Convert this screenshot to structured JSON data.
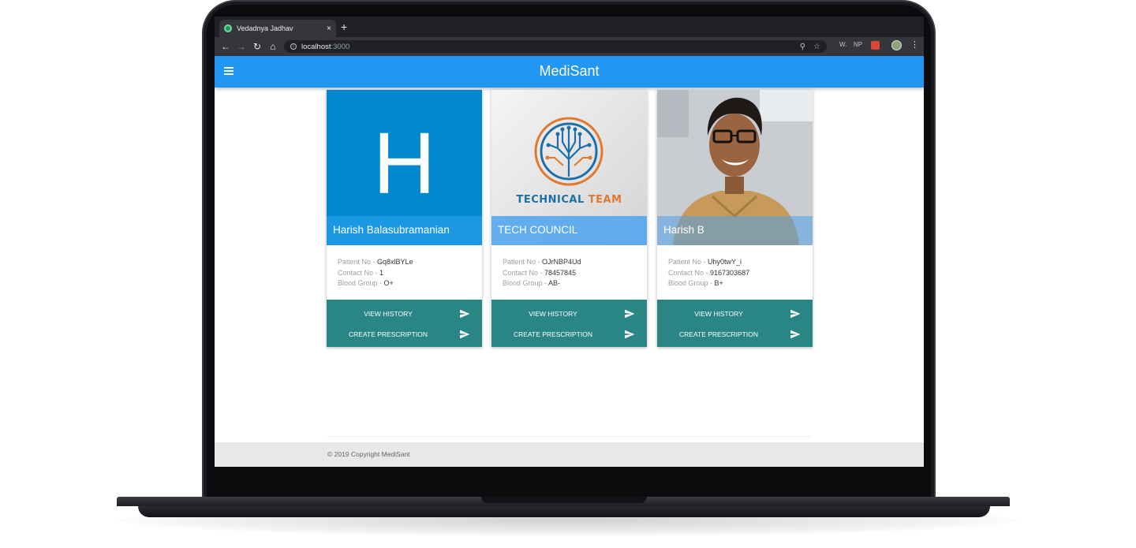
{
  "browser": {
    "tab_title": "Vedadnya Jadhav",
    "tab_close": "×",
    "new_tab": "+",
    "url_host": "localhost",
    "url_port": ":3000",
    "extensions": {
      "w_label": "W.",
      "np_label": "NP"
    },
    "icons": [
      "back-arrow-icon",
      "forward-arrow-icon",
      "reload-icon",
      "home-icon",
      "info-icon",
      "zoom-icon",
      "bookmark-star-icon",
      "extension-icon",
      "profile-avatar-icon",
      "kebab-menu-icon"
    ]
  },
  "app": {
    "title": "MediSant",
    "accent_color": "#2196f3",
    "action_color": "#2a8585"
  },
  "patients": [
    {
      "avatar_letter": "H",
      "name": "Harish Balasubramanian",
      "patient_label": "Patient No - ",
      "patient_no": "Gq8xlBYLe",
      "contact_label": "Contact No - ",
      "contact_no": "1",
      "blood_label": "Blood Group - ",
      "blood_group": "O+",
      "view_history": "VIEW HISTORY",
      "create_prescription": "CREATE PRESCRIPTION"
    },
    {
      "logo_text_1": "TECHNICAL ",
      "logo_text_2": "TEAM",
      "name": "TECH COUNCIL",
      "patient_label": "Patient No - ",
      "patient_no": "OJrNBP4Ud",
      "contact_label": "Contact No - ",
      "contact_no": "78457845",
      "blood_label": "Blood Group - ",
      "blood_group": "AB-",
      "view_history": "VIEW HISTORY",
      "create_prescription": "CREATE PRESCRIPTION"
    },
    {
      "name": "Harish B",
      "patient_label": "Patient No - ",
      "patient_no": "Uhy0twY_i",
      "contact_label": "Contact No - ",
      "contact_no": "9167303687",
      "blood_label": "Blood Group - ",
      "blood_group": "B+",
      "view_history": "VIEW HISTORY",
      "create_prescription": "CREATE PRESCRIPTION"
    }
  ],
  "footer": {
    "copyright": "© 2019 Copyright MediSant"
  }
}
